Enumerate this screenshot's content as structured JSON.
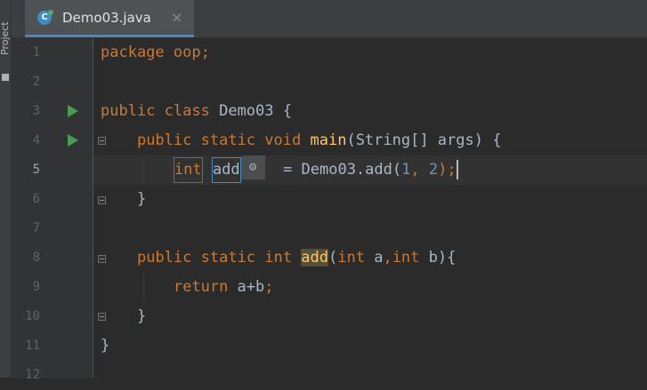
{
  "sidebar": {
    "project_label": "Project"
  },
  "tab": {
    "filename": "Demo03.java",
    "icon_letter": "C",
    "close_glyph": "×"
  },
  "gutter": {
    "line_numbers": [
      "1",
      "2",
      "3",
      "4",
      "5",
      "6",
      "7",
      "8",
      "9",
      "10",
      "11",
      "12"
    ],
    "current_line": "5"
  },
  "code": {
    "l1_kw": "package",
    "l1_rest": " oop;",
    "l3_kw1": "public",
    "l3_kw2": "class",
    "l3_name": " Demo03 {",
    "l4_kw1": "public",
    "l4_kw2": "static",
    "l4_kw3": "void",
    "l4_fn": "main",
    "l4_rest": "(String[] args) {",
    "l5_type": "int",
    "l5_var": "add",
    "l5_icon": "⚙",
    "l5_mid": "  = Demo03.add(",
    "l5_arg1": "1",
    "l5_comma": ", ",
    "l5_arg2": "2",
    "l5_end": ");",
    "l6_brace": "}",
    "l8_kw1": "public",
    "l8_kw2": "static",
    "l8_kw3": "int",
    "l8_fn": "add",
    "l8_p1": "(",
    "l8_kw4": "int",
    "l8_p2": " a",
    "l8_comma": ",",
    "l8_kw5": "int",
    "l8_p3": " b){",
    "l9_kw": "return",
    "l9_rest": " a+b",
    "l9_semi": ";",
    "l10_brace": "}",
    "l11_brace": "}"
  },
  "colors": {
    "background": "#2b2b2b",
    "keyword": "#cc7832",
    "function": "#ffc66d",
    "number": "#6897bb",
    "text": "#a9b7c6",
    "run_icon": "#499c54",
    "tab_underline": "#4a88c7"
  },
  "icons": [
    "java-class-icon",
    "close-icon",
    "run-icon",
    "fold-icon",
    "gear-icon"
  ]
}
